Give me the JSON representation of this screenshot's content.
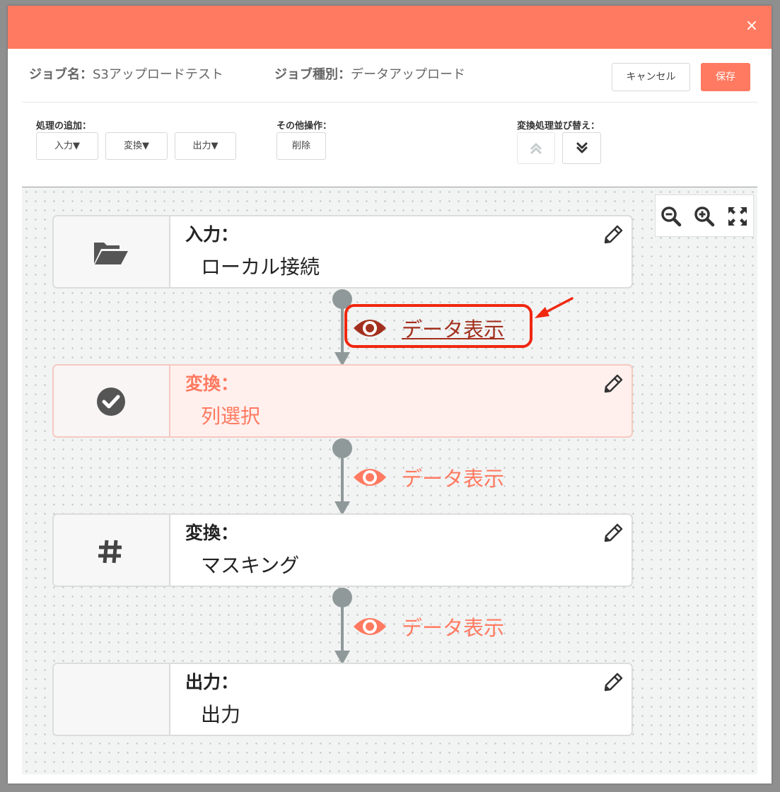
{
  "header": {
    "close_label": "×"
  },
  "job": {
    "name_label": "ジョブ名：",
    "name_value": "S3アップロードテスト",
    "type_label": "ジョブ種別：",
    "type_value": "データアップロード"
  },
  "actions": {
    "cancel_label": "キャンセル",
    "save_label": "保存"
  },
  "toolbar": {
    "add_label": "処理の追加：",
    "add_buttons": [
      "入力▼",
      "変換▼",
      "出力▼"
    ],
    "other_label": "その他操作：",
    "delete_label": "削除",
    "reorder_label": "変換処理並び替え："
  },
  "zoom": {
    "icons": [
      "zoom-out-icon",
      "zoom-in-icon",
      "fit-screen-icon"
    ]
  },
  "nodes": [
    {
      "icon": "folder-open-icon",
      "title": "入力：",
      "value": "ローカル接続",
      "selected": false
    },
    {
      "icon": "check-circle-icon",
      "title": "変換：",
      "value": "列選択",
      "selected": true
    },
    {
      "icon": "hash-icon",
      "title": "変換：",
      "value": "マスキング",
      "selected": false
    },
    {
      "icon": "none",
      "title": "出力：",
      "value": "出力",
      "selected": false
    }
  ],
  "data_views": [
    {
      "label": "データ表示",
      "active": true
    },
    {
      "label": "データ表示",
      "active": false
    },
    {
      "label": "データ表示",
      "active": false
    }
  ],
  "colors": {
    "accent": "#ff7a60",
    "active_link": "#a3301e",
    "highlight": "#f0270f",
    "connector": "#909999"
  }
}
